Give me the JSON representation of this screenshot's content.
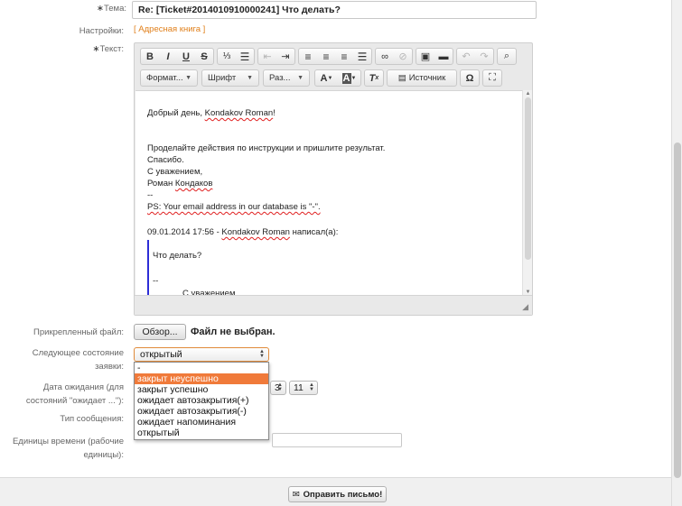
{
  "form": {
    "subject_label": "Тема:",
    "subject_value": "Re: [Ticket#2014010910000241] Что делать?",
    "settings_label": "Настройки:",
    "address_book": "[ Адресная книга ]",
    "text_label": "Текст:"
  },
  "editor": {
    "combos": {
      "format": "Формат...",
      "font": "Шрифт",
      "size": "Раз...",
      "source": "Источник"
    },
    "content": {
      "greeting_pre": "Добрый день, ",
      "greeting_name": "Kondakov Roman",
      "greeting_post": "!",
      "instruction": "Проделайте действия по инструкции и пришлите результат.",
      "thanks": "Спасибо.",
      "regards": "С уважением,",
      "sig_first": "Роман ",
      "sig_last": "Кондаков",
      "dashes": "--",
      "ps_tag": "PS",
      "ps_text": ": Your email address in our database is \"-\".",
      "quote_pre": "09.01.2014 17:56 - ",
      "quote_name": "Kondakov Roman",
      "quote_post": " написал(а):",
      "quoted_question": "Что делать?",
      "quoted_dashes": "--",
      "quoted_regards": "С уважением,"
    }
  },
  "attachment": {
    "label": "Прикрепленный файл:",
    "browse_button": "Обзор...",
    "no_file": "Файл не выбран."
  },
  "next_state": {
    "label_line1": "Следующее состояние",
    "label_line2": "заявки:",
    "selected": "открытый",
    "options": [
      "-",
      "закрыт неуспешно",
      "закрыт успешно",
      "ожидает автозакрытия(+)",
      "ожидает автозакрытия(-)",
      "ожидает напоминания",
      "открытый"
    ],
    "highlighted_index": 1
  },
  "pending_date": {
    "label_line1": "Дата ожидания (для",
    "label_line2": "состояний \"ожидает ...\"):",
    "hour_partial": "3",
    "minute": "11"
  },
  "message_type": {
    "label": "Тип сообщения:"
  },
  "time_units": {
    "label_line1": "Единицы времени (рабочие",
    "label_line2": "единицы):"
  },
  "footer": {
    "send_button": "Оправить письмо!"
  },
  "colors": {
    "accent": "#f07a3a",
    "link": "#e07f1a",
    "quote_bar": "#2d2dd6"
  }
}
